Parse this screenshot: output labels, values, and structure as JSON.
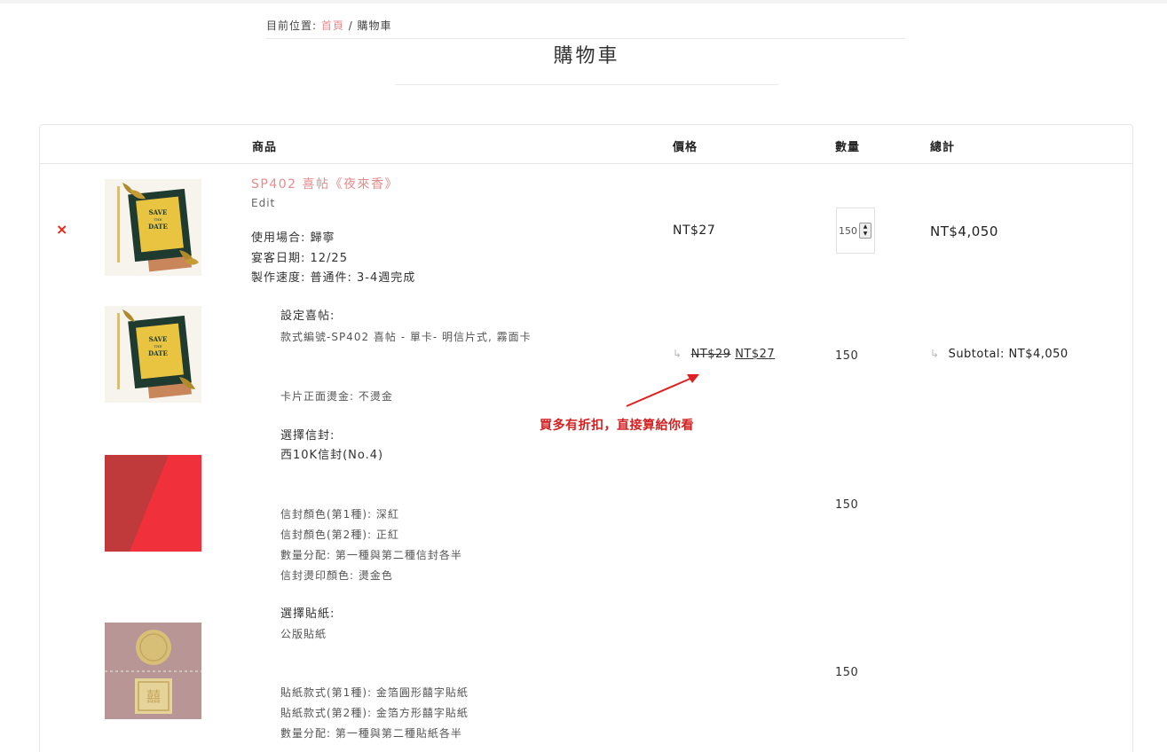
{
  "breadcrumb": {
    "prefix": "目前位置: ",
    "home": "首頁",
    "sep": " / ",
    "current": "購物車"
  },
  "page_title": "購物車",
  "table": {
    "headers": {
      "product": "商品",
      "price": "價格",
      "quantity": "數量",
      "total": "總計"
    }
  },
  "item": {
    "remove": "×",
    "name": "SP402 喜帖《夜來香》",
    "edit": "Edit",
    "meta": [
      "使用場合: 歸寧",
      "宴客日期: 12/25",
      "製作速度: 普通件: 3-4週完成"
    ],
    "price": "NT$27",
    "quantity": "150",
    "total": "NT$4,050"
  },
  "sub_card": {
    "label": "設定喜帖:",
    "style": "款式編號-SP402 喜帖 - 單卡- 明信片式, 霧面卡",
    "foil": "卡片正面燙金: 不燙金",
    "arrow": "↳",
    "old_price": "NT$29",
    "new_price": "NT$27",
    "quantity": "150",
    "subtotal": "Subtotal: NT$4,050"
  },
  "annotation": "買多有折扣，直接算給你看",
  "sub_envelope": {
    "label": "選擇信封:",
    "value": "西10K信封(No.4)",
    "details": [
      "信封顏色(第1種): 深紅",
      "信封顏色(第2種): 正紅",
      "數量分配: 第一種與第二種信封各半",
      "信封燙印顏色: 燙金色"
    ],
    "quantity": "150"
  },
  "sub_sticker": {
    "label": "選擇貼紙:",
    "value": "公版貼紙",
    "details": [
      "貼紙款式(第1種): 金箔圓形囍字貼紙",
      "貼紙款式(第2種): 金箔方形囍字貼紙",
      "數量分配: 第一種與第二種貼紙各半"
    ],
    "quantity": "150"
  },
  "invitation_card_text": {
    "line1": "SAVE",
    "line2": "THE",
    "line3": "DATE"
  },
  "sticker_glyph": "囍",
  "colors": {
    "accent": "#e88b8b",
    "remove": "#e21111",
    "annotation": "#d42020",
    "envelope_dark": "#c0393b",
    "envelope_red": "#f0303a",
    "sticker_bg": "#b89696",
    "gold": "#d8bf78"
  }
}
